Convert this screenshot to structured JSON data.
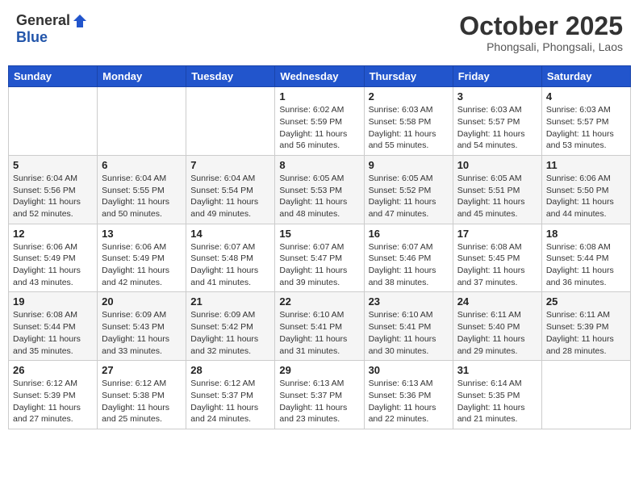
{
  "logo": {
    "general": "General",
    "blue": "Blue",
    "tagline": ""
  },
  "header": {
    "month": "October 2025",
    "location": "Phongsali, Phongsali, Laos"
  },
  "weekdays": [
    "Sunday",
    "Monday",
    "Tuesday",
    "Wednesday",
    "Thursday",
    "Friday",
    "Saturday"
  ],
  "weeks": [
    [
      {
        "day": "",
        "sunrise": "",
        "sunset": "",
        "daylight": ""
      },
      {
        "day": "",
        "sunrise": "",
        "sunset": "",
        "daylight": ""
      },
      {
        "day": "",
        "sunrise": "",
        "sunset": "",
        "daylight": ""
      },
      {
        "day": "1",
        "sunrise": "Sunrise: 6:02 AM",
        "sunset": "Sunset: 5:59 PM",
        "daylight": "Daylight: 11 hours and 56 minutes."
      },
      {
        "day": "2",
        "sunrise": "Sunrise: 6:03 AM",
        "sunset": "Sunset: 5:58 PM",
        "daylight": "Daylight: 11 hours and 55 minutes."
      },
      {
        "day": "3",
        "sunrise": "Sunrise: 6:03 AM",
        "sunset": "Sunset: 5:57 PM",
        "daylight": "Daylight: 11 hours and 54 minutes."
      },
      {
        "day": "4",
        "sunrise": "Sunrise: 6:03 AM",
        "sunset": "Sunset: 5:57 PM",
        "daylight": "Daylight: 11 hours and 53 minutes."
      }
    ],
    [
      {
        "day": "5",
        "sunrise": "Sunrise: 6:04 AM",
        "sunset": "Sunset: 5:56 PM",
        "daylight": "Daylight: 11 hours and 52 minutes."
      },
      {
        "day": "6",
        "sunrise": "Sunrise: 6:04 AM",
        "sunset": "Sunset: 5:55 PM",
        "daylight": "Daylight: 11 hours and 50 minutes."
      },
      {
        "day": "7",
        "sunrise": "Sunrise: 6:04 AM",
        "sunset": "Sunset: 5:54 PM",
        "daylight": "Daylight: 11 hours and 49 minutes."
      },
      {
        "day": "8",
        "sunrise": "Sunrise: 6:05 AM",
        "sunset": "Sunset: 5:53 PM",
        "daylight": "Daylight: 11 hours and 48 minutes."
      },
      {
        "day": "9",
        "sunrise": "Sunrise: 6:05 AM",
        "sunset": "Sunset: 5:52 PM",
        "daylight": "Daylight: 11 hours and 47 minutes."
      },
      {
        "day": "10",
        "sunrise": "Sunrise: 6:05 AM",
        "sunset": "Sunset: 5:51 PM",
        "daylight": "Daylight: 11 hours and 45 minutes."
      },
      {
        "day": "11",
        "sunrise": "Sunrise: 6:06 AM",
        "sunset": "Sunset: 5:50 PM",
        "daylight": "Daylight: 11 hours and 44 minutes."
      }
    ],
    [
      {
        "day": "12",
        "sunrise": "Sunrise: 6:06 AM",
        "sunset": "Sunset: 5:49 PM",
        "daylight": "Daylight: 11 hours and 43 minutes."
      },
      {
        "day": "13",
        "sunrise": "Sunrise: 6:06 AM",
        "sunset": "Sunset: 5:49 PM",
        "daylight": "Daylight: 11 hours and 42 minutes."
      },
      {
        "day": "14",
        "sunrise": "Sunrise: 6:07 AM",
        "sunset": "Sunset: 5:48 PM",
        "daylight": "Daylight: 11 hours and 41 minutes."
      },
      {
        "day": "15",
        "sunrise": "Sunrise: 6:07 AM",
        "sunset": "Sunset: 5:47 PM",
        "daylight": "Daylight: 11 hours and 39 minutes."
      },
      {
        "day": "16",
        "sunrise": "Sunrise: 6:07 AM",
        "sunset": "Sunset: 5:46 PM",
        "daylight": "Daylight: 11 hours and 38 minutes."
      },
      {
        "day": "17",
        "sunrise": "Sunrise: 6:08 AM",
        "sunset": "Sunset: 5:45 PM",
        "daylight": "Daylight: 11 hours and 37 minutes."
      },
      {
        "day": "18",
        "sunrise": "Sunrise: 6:08 AM",
        "sunset": "Sunset: 5:44 PM",
        "daylight": "Daylight: 11 hours and 36 minutes."
      }
    ],
    [
      {
        "day": "19",
        "sunrise": "Sunrise: 6:08 AM",
        "sunset": "Sunset: 5:44 PM",
        "daylight": "Daylight: 11 hours and 35 minutes."
      },
      {
        "day": "20",
        "sunrise": "Sunrise: 6:09 AM",
        "sunset": "Sunset: 5:43 PM",
        "daylight": "Daylight: 11 hours and 33 minutes."
      },
      {
        "day": "21",
        "sunrise": "Sunrise: 6:09 AM",
        "sunset": "Sunset: 5:42 PM",
        "daylight": "Daylight: 11 hours and 32 minutes."
      },
      {
        "day": "22",
        "sunrise": "Sunrise: 6:10 AM",
        "sunset": "Sunset: 5:41 PM",
        "daylight": "Daylight: 11 hours and 31 minutes."
      },
      {
        "day": "23",
        "sunrise": "Sunrise: 6:10 AM",
        "sunset": "Sunset: 5:41 PM",
        "daylight": "Daylight: 11 hours and 30 minutes."
      },
      {
        "day": "24",
        "sunrise": "Sunrise: 6:11 AM",
        "sunset": "Sunset: 5:40 PM",
        "daylight": "Daylight: 11 hours and 29 minutes."
      },
      {
        "day": "25",
        "sunrise": "Sunrise: 6:11 AM",
        "sunset": "Sunset: 5:39 PM",
        "daylight": "Daylight: 11 hours and 28 minutes."
      }
    ],
    [
      {
        "day": "26",
        "sunrise": "Sunrise: 6:12 AM",
        "sunset": "Sunset: 5:39 PM",
        "daylight": "Daylight: 11 hours and 27 minutes."
      },
      {
        "day": "27",
        "sunrise": "Sunrise: 6:12 AM",
        "sunset": "Sunset: 5:38 PM",
        "daylight": "Daylight: 11 hours and 25 minutes."
      },
      {
        "day": "28",
        "sunrise": "Sunrise: 6:12 AM",
        "sunset": "Sunset: 5:37 PM",
        "daylight": "Daylight: 11 hours and 24 minutes."
      },
      {
        "day": "29",
        "sunrise": "Sunrise: 6:13 AM",
        "sunset": "Sunset: 5:37 PM",
        "daylight": "Daylight: 11 hours and 23 minutes."
      },
      {
        "day": "30",
        "sunrise": "Sunrise: 6:13 AM",
        "sunset": "Sunset: 5:36 PM",
        "daylight": "Daylight: 11 hours and 22 minutes."
      },
      {
        "day": "31",
        "sunrise": "Sunrise: 6:14 AM",
        "sunset": "Sunset: 5:35 PM",
        "daylight": "Daylight: 11 hours and 21 minutes."
      },
      {
        "day": "",
        "sunrise": "",
        "sunset": "",
        "daylight": ""
      }
    ]
  ]
}
